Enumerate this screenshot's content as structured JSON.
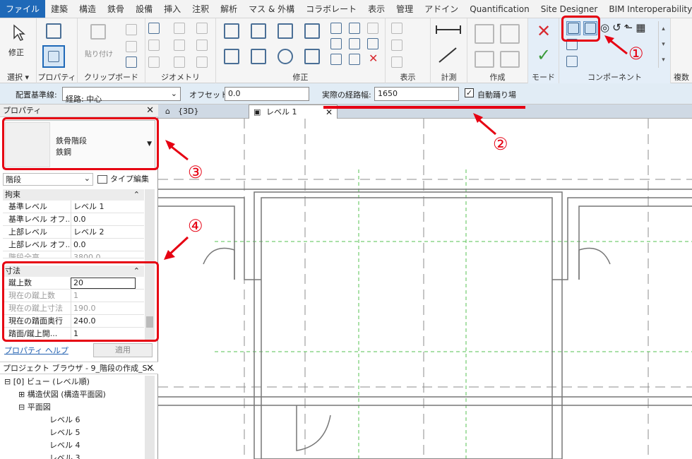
{
  "menu": [
    "ファイル",
    "建築",
    "構造",
    "鉄骨",
    "設備",
    "挿入",
    "注釈",
    "解析",
    "マス & 外構",
    "コラボレート",
    "表示",
    "管理",
    "アドイン",
    "Quantification",
    "Site Designer",
    "BIM Interoperability Tools"
  ],
  "ribbon": {
    "select": {
      "modify": "修正",
      "title": "選択 ▾"
    },
    "properties_title": "プロパティ",
    "clipboard": {
      "paste": "貼り付け",
      "title": "クリップボード"
    },
    "geometry_title": "ジオメトリ",
    "modify_title": "修正",
    "view_title": "表示",
    "measure_title": "計測",
    "create_title": "作成",
    "mode_title": "モード",
    "component_title": "コンポーネント",
    "multi_title": "複数"
  },
  "options": {
    "location_label": "配置基準線:",
    "location_value": "経路: 中心",
    "offset_label": "オフセット:",
    "offset_value": "0.0",
    "width_label": "実際の経路幅:",
    "width_value": "1650",
    "auto_label": "自動踊り場"
  },
  "tabs": {
    "tab3d": "{3D}",
    "level1": "レベル 1"
  },
  "properties": {
    "title": "プロパティ",
    "type_name": "鉄骨階段",
    "type_sub": "鉄鋼",
    "category": "階段",
    "edit_type": "タイプ編集",
    "constraints": "拘束",
    "rows1": [
      {
        "k": "基準レベル",
        "v": "レベル 1"
      },
      {
        "k": "基準レベル オフ...",
        "v": "0.0"
      },
      {
        "k": "上部レベル",
        "v": "レベル 2"
      },
      {
        "k": "上部レベル オフ...",
        "v": "0.0"
      },
      {
        "k": "階段全高",
        "v": "3800.0"
      }
    ],
    "dimensions": "寸法",
    "rows2": [
      {
        "k": "蹴上数",
        "v": "20"
      },
      {
        "k": "現在の蹴上数",
        "v": "1"
      },
      {
        "k": "現在の蹴上寸法",
        "v": "190.0"
      },
      {
        "k": "現在の踏面奥行",
        "v": "240.0"
      },
      {
        "k": "踏面/蹴上開...",
        "v": "1"
      }
    ],
    "help": "プロパティ ヘルプ",
    "apply": "適用"
  },
  "browser": {
    "title": "プロジェクト ブラウザ - 9_階段の作成_S...",
    "items": [
      "ビュー (レベル順)",
      "構造伏図 (構造平面図)",
      "平面図",
      "レベル 6",
      "レベル 5",
      "レベル 4",
      "レベル 3"
    ]
  },
  "annotations": [
    "①",
    "②",
    "③",
    "④"
  ]
}
